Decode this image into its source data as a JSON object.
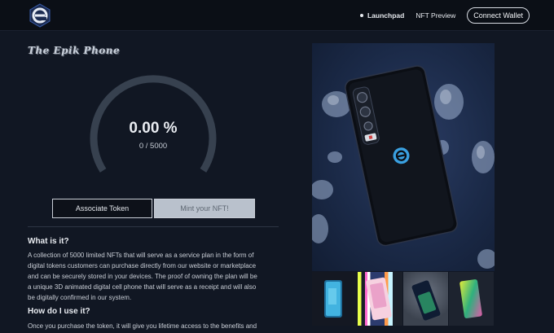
{
  "header": {
    "nav": [
      {
        "label": "Launchpad",
        "active": true
      },
      {
        "label": "NFT Preview",
        "active": false
      }
    ],
    "connect_label": "Connect Wallet"
  },
  "main": {
    "title": "The Epik Phone",
    "progress": {
      "percent_text": "0.00 %",
      "count_text": "0 / 5000",
      "fraction": 0.0
    },
    "buttons": {
      "associate": "Associate Token",
      "mint": "Mint your NFT!"
    },
    "sections": [
      {
        "heading": "What is it?",
        "lines": [
          "A collection of 5000 limited NFTs that will serve as a service plan in the form of",
          "digital tokens customers can purchase directly from our website or marketplace",
          "and can be securely stored in your devices. The proof of owning the plan will be",
          "a unique 3D animated digital cell phone that will serve as a receipt and will also",
          "be digitally confirmed in our system."
        ]
      },
      {
        "heading": "How do I use it?",
        "lines": [
          "Once you purchase the token, it will give you lifetime access to the benefits and"
        ]
      }
    ]
  },
  "colors": {
    "background": "#111723",
    "header": "#0b0f16",
    "gauge_track": "#37414f",
    "mint_button": "#b9c1cc",
    "accent_blue": "#3aa0e0"
  },
  "icons": {
    "logo": "epik-logo-icon",
    "phone_logo": "epik-e-icon"
  }
}
